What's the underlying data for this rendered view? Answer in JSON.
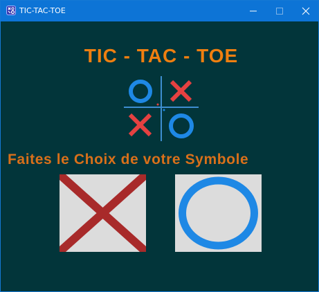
{
  "window": {
    "title": "TIC-TAC-TOE",
    "titlebar_color": "#0d74d6",
    "background_color": "#02353a"
  },
  "header": {
    "title": "TIC - TAC - TOE",
    "title_color": "#ef7f10"
  },
  "logo": {
    "icons": [
      "circle-icon",
      "cross-icon",
      "cross-icon",
      "circle-icon"
    ],
    "circle_color": "#1e88e5",
    "cross_color": "#e54141",
    "grid_color": "#3e8ed0"
  },
  "prompt": {
    "text": "Faites le Choix de votre Symbole",
    "color": "#d9701a"
  },
  "choices": [
    {
      "symbol": "x-symbol-icon",
      "color": "#a82a2a"
    },
    {
      "symbol": "o-symbol-icon",
      "color": "#1e88e5"
    }
  ]
}
